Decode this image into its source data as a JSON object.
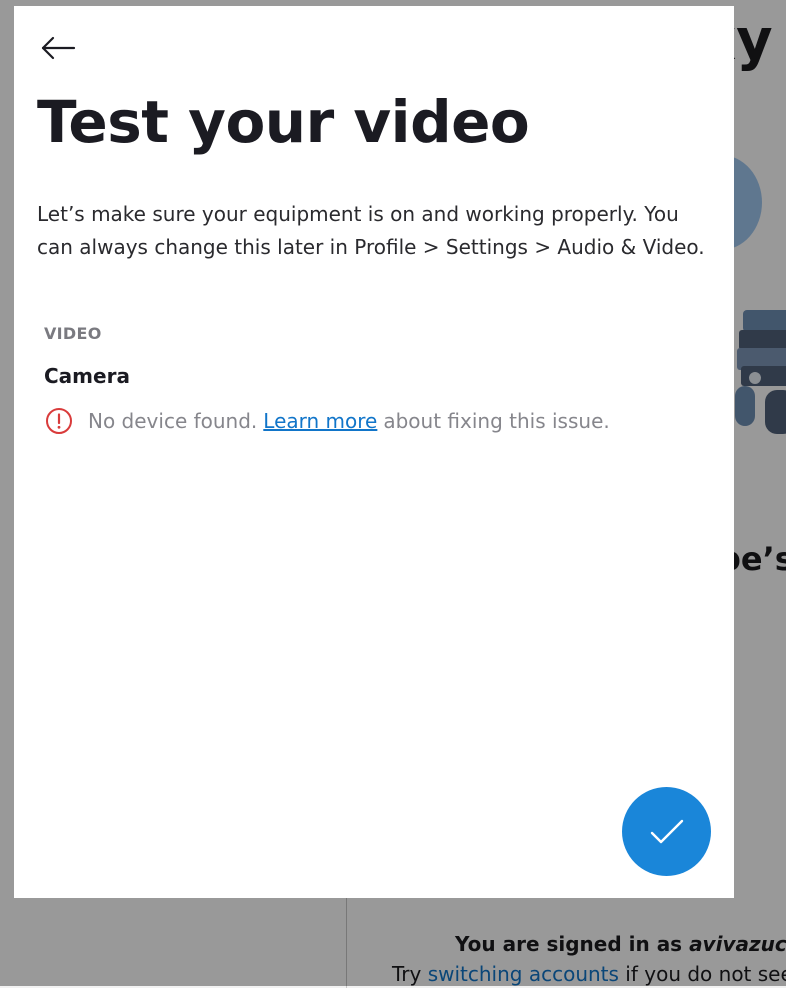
{
  "modal": {
    "title": "Test your video",
    "description": "Let’s make sure your equipment is on and working properly. You can always change this later in Profile > Settings > Audio & Video.",
    "section_label": "VIDEO",
    "camera_label": "Camera",
    "status_prefix": "No device found.",
    "learn_more_link": "Learn more",
    "status_suffix": "about fixing this issue.",
    "back_icon": "arrow-left-icon",
    "error_icon": "error-circle-icon",
    "confirm_icon": "checkmark-icon"
  },
  "background": {
    "brand_partial": "xy",
    "heading_partial": "pe’s",
    "signed_in_prefix": "You are signed in as",
    "signed_in_user": "avivazuck",
    "switch_prefix": "Try",
    "switch_link": "switching accounts",
    "switch_suffix": "if you do not see"
  },
  "colors": {
    "accent": "#1A86D9",
    "link": "#1175C9",
    "error": "#D93B3B",
    "overlay": "rgba(0,0,0,0.40)"
  }
}
